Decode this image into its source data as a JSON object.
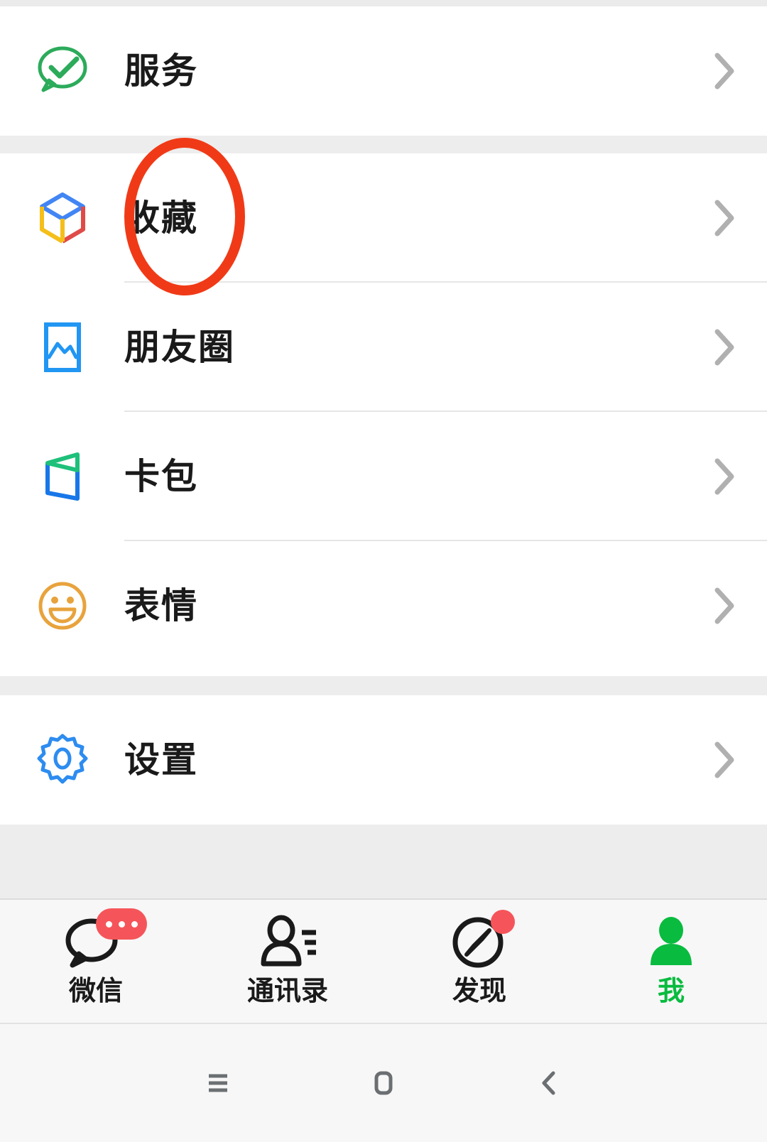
{
  "app": {
    "name": "WeChat",
    "screen": "Me",
    "accent_green": "#09bb3f",
    "badge_red": "#f5555a",
    "annotation_red": "#f03a17",
    "background_gray": "#ededed",
    "card_white": "#ffffff",
    "chevron_gray": "#b0b0b0"
  },
  "sections": [
    {
      "name": "services",
      "rows": [
        {
          "label": "服务",
          "icon": "services-bubble-check-icon",
          "icon_color": "#2cab5b",
          "chevron": "chevron-right-icon"
        }
      ]
    },
    {
      "name": "content",
      "rows": [
        {
          "label": "收藏",
          "icon": "favorites-cube-icon",
          "icon_color": "#4285f4",
          "chevron": "chevron-right-icon",
          "annotated": true
        },
        {
          "label": "朋友圈",
          "icon": "moments-photo-icon",
          "icon_color": "#2196f3",
          "chevron": "chevron-right-icon"
        },
        {
          "label": "卡包",
          "icon": "cards-wallet-icon",
          "icon_color": "#1877e8",
          "chevron": "chevron-right-icon"
        },
        {
          "label": "表情",
          "icon": "stickers-smiley-icon",
          "icon_color": "#e8a33d",
          "chevron": "chevron-right-icon"
        }
      ]
    },
    {
      "name": "settings",
      "rows": [
        {
          "label": "设置",
          "icon": "settings-gear-icon",
          "icon_color": "#2d8cf0",
          "chevron": "chevron-right-icon"
        }
      ]
    }
  ],
  "annotation": {
    "shape": "ellipse",
    "color": "#f03a17",
    "target_label": "收藏",
    "stroke_width": 13
  },
  "tabbar": {
    "tabs": [
      {
        "label": "微信",
        "icon": "chat-bubble-icon",
        "active": false,
        "badge": {
          "type": "pill-dots",
          "dots": 3,
          "color": "#f5555a"
        }
      },
      {
        "label": "通讯录",
        "icon": "contacts-person-icon",
        "active": false,
        "badge": null
      },
      {
        "label": "发现",
        "icon": "discover-compass-icon",
        "active": false,
        "badge": {
          "type": "dot",
          "color": "#f5555a"
        }
      },
      {
        "label": "我",
        "icon": "me-person-filled-icon",
        "active": true,
        "badge": null
      }
    ]
  },
  "navbar": {
    "buttons": [
      {
        "label": "recents",
        "icon": "menu-lines-icon"
      },
      {
        "label": "home",
        "icon": "home-rounded-rect-icon"
      },
      {
        "label": "back",
        "icon": "back-chevron-icon"
      }
    ]
  }
}
